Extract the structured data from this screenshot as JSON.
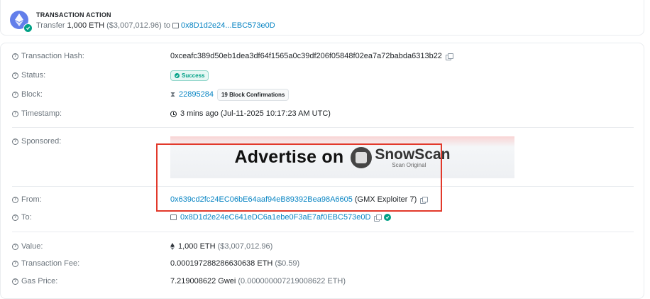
{
  "action": {
    "title": "TRANSACTION ACTION",
    "verb": "Transfer",
    "amount": "1,000 ETH",
    "usd": "($3,007,012.96)",
    "to_word": "to",
    "to_address": "0x8D1d2e24...EBC573e0D"
  },
  "details": {
    "tx_hash": {
      "label": "Transaction Hash:",
      "value": "0xceafc389d50eb1dea3df64f1565a0c39df206f05848f02ea7a72babda6313b22"
    },
    "status": {
      "label": "Status:",
      "value": "Success"
    },
    "block": {
      "label": "Block:",
      "number": "22895284",
      "confirmations": "19 Block Confirmations"
    },
    "timestamp": {
      "label": "Timestamp:",
      "value": "3 mins ago (Jul-11-2025 10:17:23 AM UTC)"
    },
    "sponsored": {
      "label": "Sponsored:",
      "ad_text": "Advertise on",
      "brand_name": "SnowScan",
      "brand_sub": "Scan Original"
    },
    "from": {
      "label": "From:",
      "address": "0x639cd2fc24EC06bE64aaf94eB89392Bea98A6605",
      "tag": "(GMX Exploiter 7)"
    },
    "to": {
      "label": "To:",
      "address": "0x8D1d2e24eC641eDC6a1ebe0F3aE7af0EBC573e0D"
    },
    "value": {
      "label": "Value:",
      "amount": "1,000 ETH",
      "usd": "($3,007,012.96)"
    },
    "fee": {
      "label": "Transaction Fee:",
      "amount": "0.000197288286630638 ETH",
      "usd": "($0.59)"
    },
    "gas_price": {
      "label": "Gas Price:",
      "amount": "7.219008622 Gwei",
      "eth": "(0.000000007219008622 ETH)"
    }
  },
  "colors": {
    "link": "#0784c3",
    "success": "#00a186",
    "highlight": "#e2392b",
    "eth": "#627eea"
  }
}
